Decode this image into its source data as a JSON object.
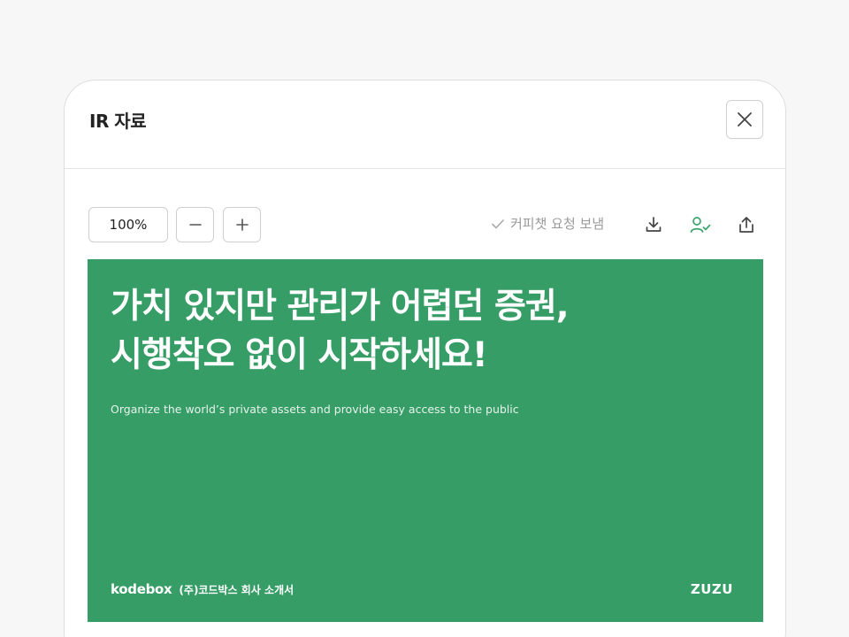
{
  "modal": {
    "title": "IR 자료",
    "close_icon": "close-icon"
  },
  "toolbar": {
    "zoom_level": "100%",
    "zoom_out_icon": "minus-icon",
    "zoom_in_icon": "plus-icon",
    "request_status": "커피챗 요청 보냄",
    "request_status_icon": "check-icon",
    "download_icon": "download-icon",
    "user_check_icon": "user-check-icon",
    "share_icon": "share-icon"
  },
  "slide": {
    "background_color": "#369d66",
    "headline_line1": "가치 있지만 관리가 어렵던 증권,",
    "headline_line2": "시행착오 없이 시작하세요!",
    "subtitle": "Organize the world’s private assets and provide easy access to the public",
    "brand_left": "kodebox",
    "company_intro": "(주)코드박스 회사 소개서",
    "brand_right": "ZUZU"
  },
  "colors": {
    "accent_green": "#369d66",
    "user_check_green": "#3aa36b",
    "muted_text": "#9a9a9a"
  }
}
